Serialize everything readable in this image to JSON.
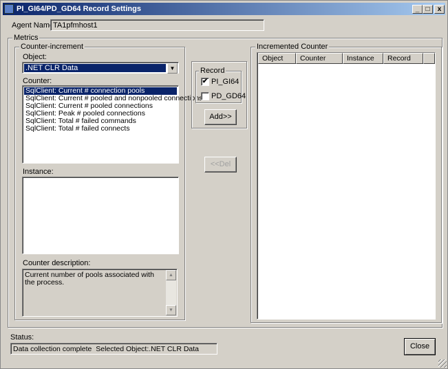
{
  "window": {
    "title": "PI_GI64/PD_GD64 Record Settings",
    "controls": [
      "_",
      "□",
      "x"
    ]
  },
  "agent": {
    "label": "Agent Name:",
    "value": "TA1pfmhost1"
  },
  "metrics": {
    "label": "Metrics"
  },
  "counter_increment": {
    "label": "Counter-increment",
    "object_label": "Object:",
    "object_value": ".NET CLR Data",
    "counter_label": "Counter:",
    "counters": [
      "SqlClient: Current # connection pools",
      "SqlClient: Current # pooled and nonpooled connections",
      "SqlClient: Current # pooled connections",
      "SqlClient: Peak # pooled connections",
      "SqlClient: Total # failed commands",
      "SqlClient: Total # failed connects"
    ],
    "selected_counter": 0,
    "instance_label": "Instance:",
    "instances": [],
    "description_label": "Counter description:",
    "description": "Current number of pools associated with the process."
  },
  "record": {
    "label": "Record",
    "options": [
      {
        "label": "PI_GI64",
        "checked": true
      },
      {
        "label": "PD_GD64",
        "checked": false
      }
    ],
    "add_label": "Add>>",
    "del_label": "<<Del"
  },
  "incremented": {
    "label": "Incremented Counter",
    "columns": [
      "Object",
      "Counter",
      "Instance",
      "Record"
    ],
    "rows": []
  },
  "status": {
    "label": "Status:",
    "value": "Data collection complete  Selected Object:.NET CLR Data"
  },
  "close_label": "Close",
  "colors": {
    "selection": "#0a246a",
    "face": "#d4d0c8"
  }
}
